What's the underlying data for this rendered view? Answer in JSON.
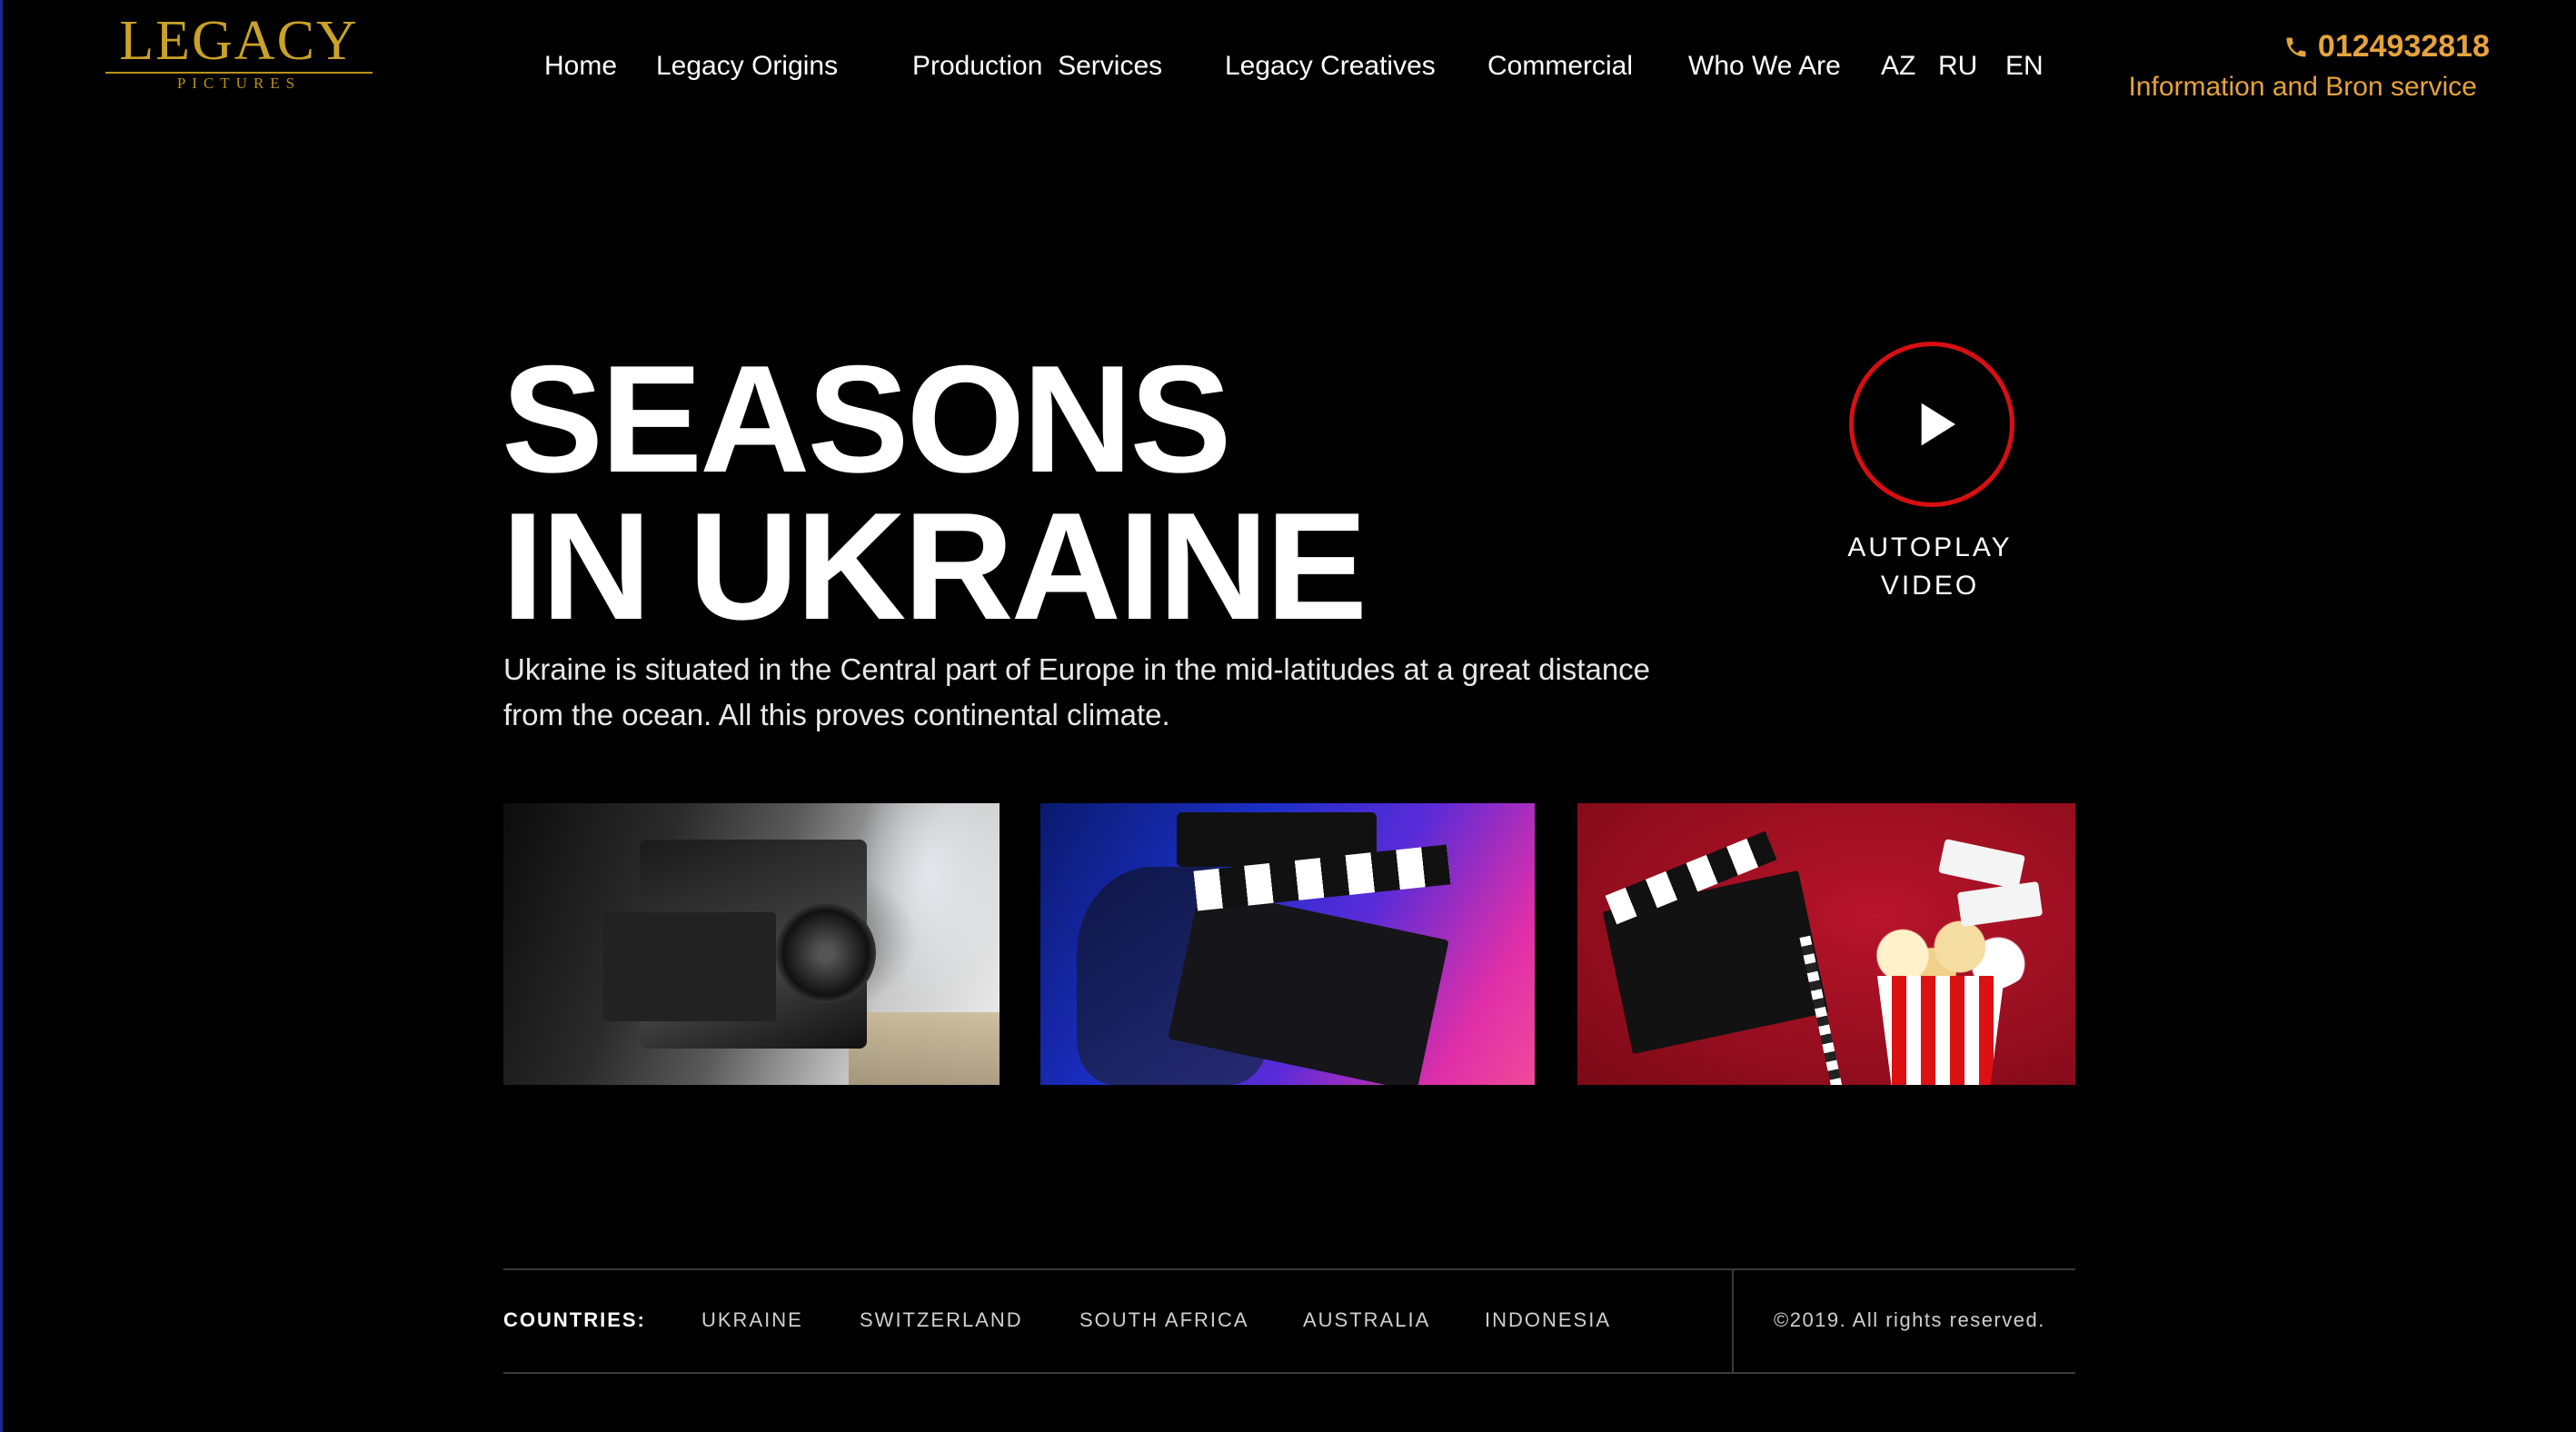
{
  "brand": {
    "name": "LEGACY",
    "sub": "PICTURES"
  },
  "nav": {
    "items": [
      "Home",
      "Legacy Origins",
      "Production  Services",
      "Legacy Creatives",
      "Commercial",
      "Who We Are"
    ],
    "languages": [
      "AZ",
      "RU",
      "EN"
    ]
  },
  "contact": {
    "phone": "0124932818",
    "service": "Information and Bron service"
  },
  "hero": {
    "title_line1": "SEASONS",
    "title_line2": "IN UKRAINE",
    "description": "Ukraine is situated in the Central part of Europe in the mid-latitudes at a great distance from the ocean. All this proves continental climate.",
    "play_label_line1": "AUTOPLAY",
    "play_label_line2": "VIDEO"
  },
  "footer": {
    "countries_label": "COUNTRIES:",
    "countries": [
      "UKRAINE",
      "SWITZERLAND",
      "SOUTH AFRICA",
      "AUSTRALIA",
      "INDONESIA"
    ],
    "copyright": "©2019. All rights reserved."
  },
  "colors": {
    "accent": "#e6a33c",
    "play_ring": "#d80f12",
    "logo_gold": "#c9a227",
    "background": "#000000"
  },
  "icons": {
    "phone": "phone-icon",
    "play": "play-icon"
  }
}
